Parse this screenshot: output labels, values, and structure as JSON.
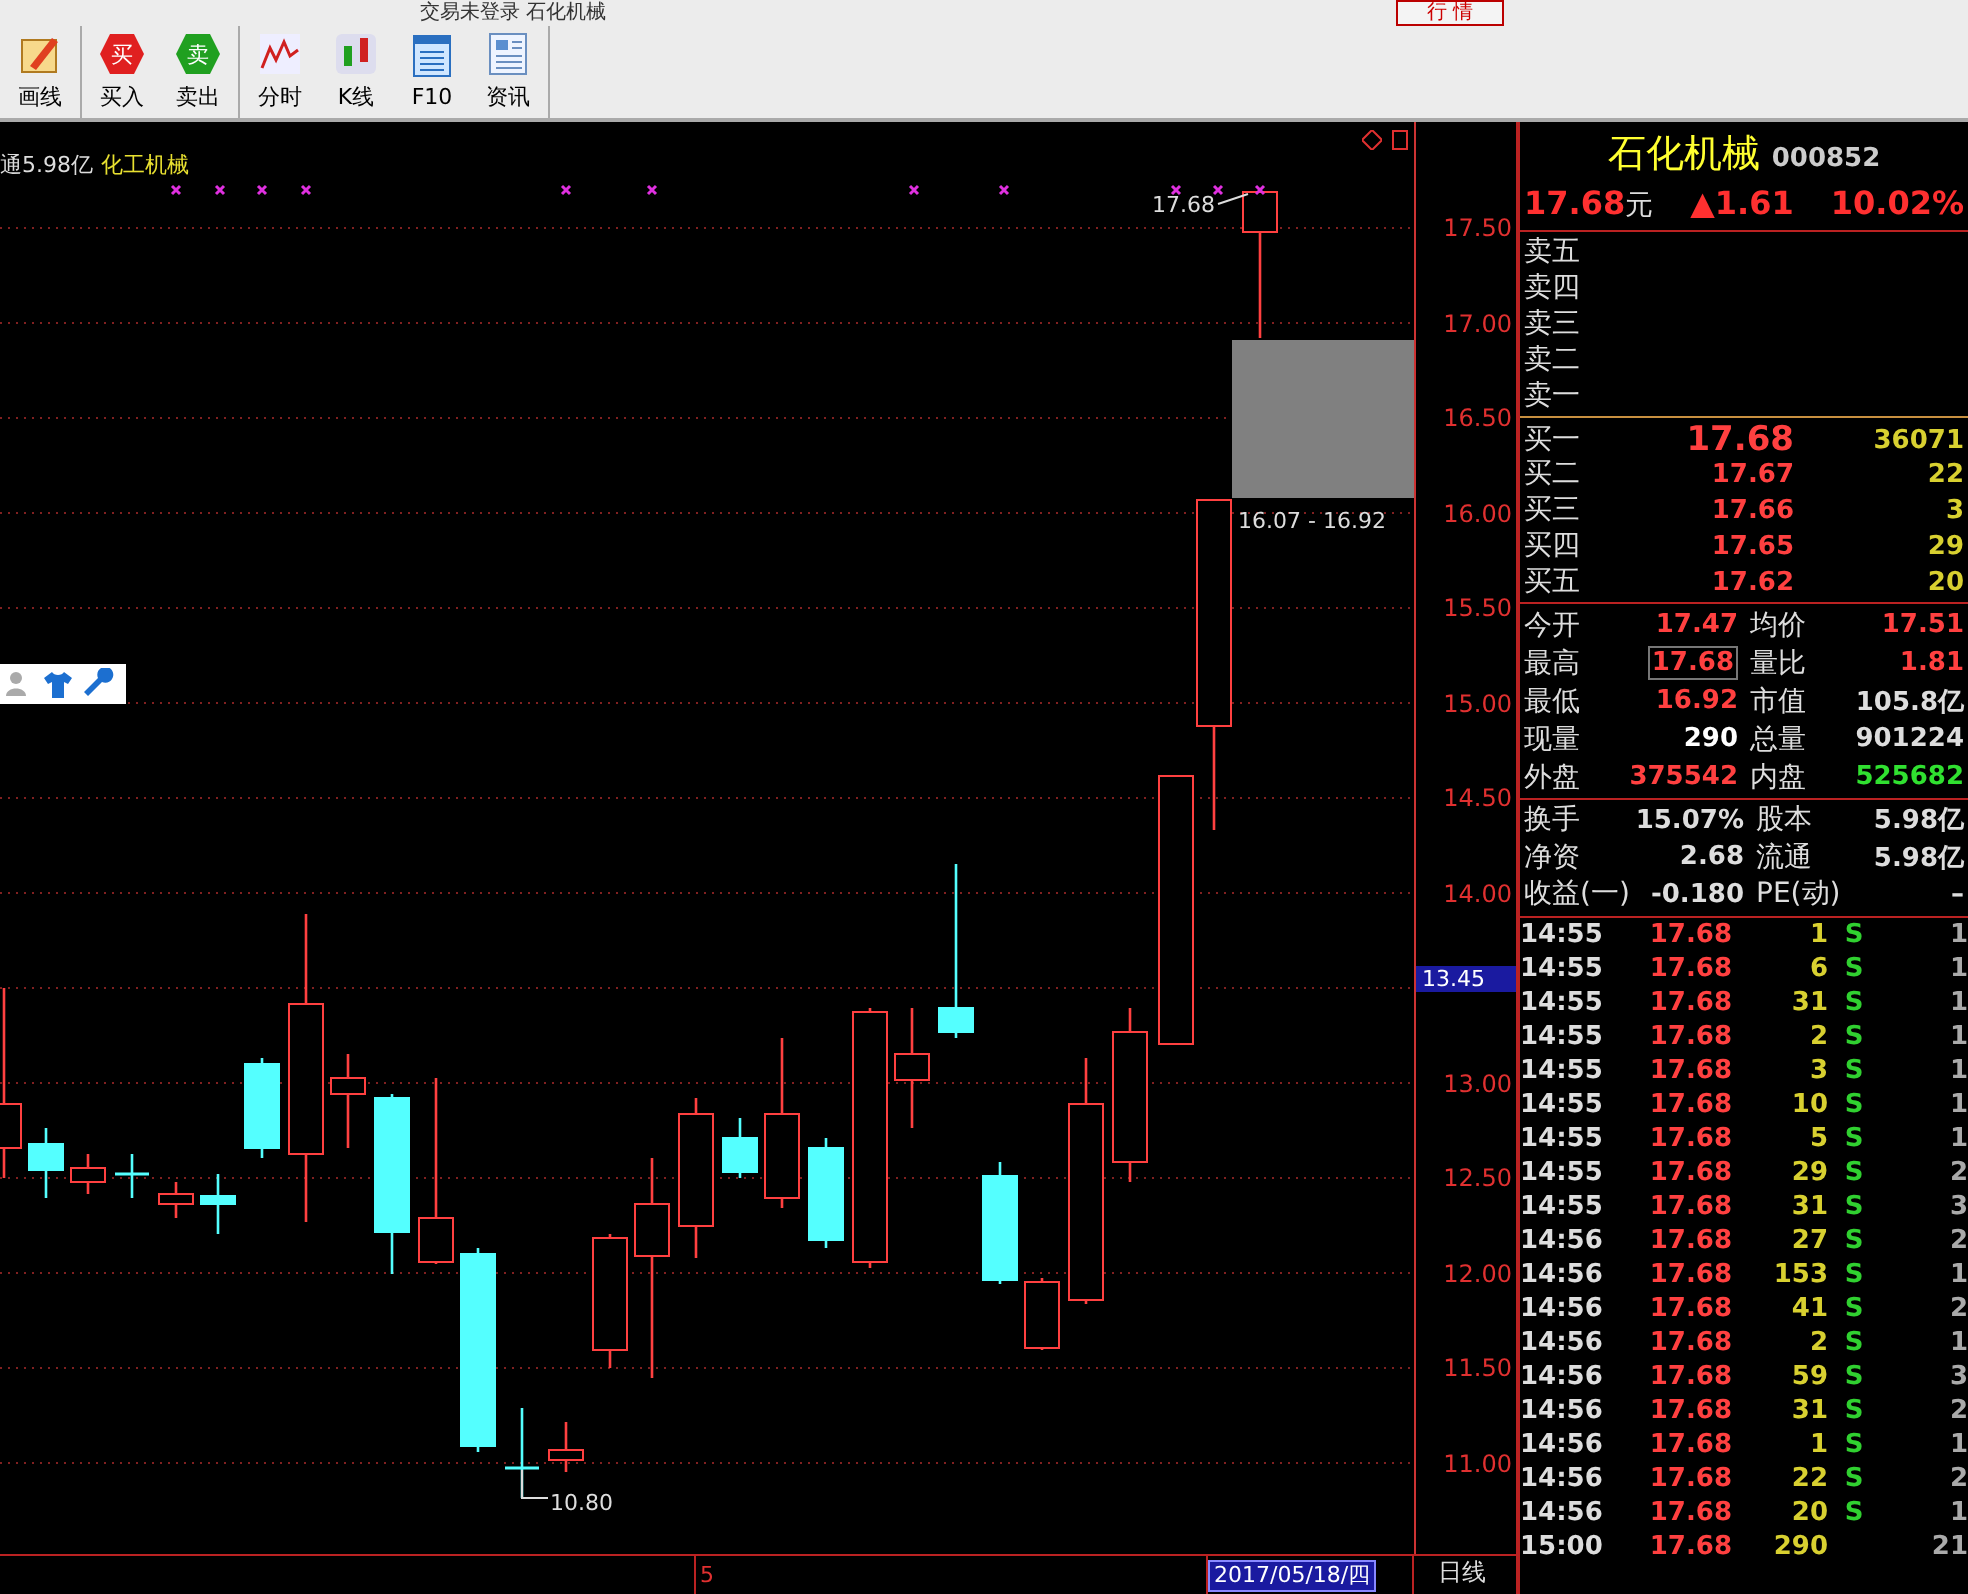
{
  "window": {
    "title": "交易未登录  石化机械",
    "mode_button": "行 情"
  },
  "toolbar": {
    "groups": [
      [
        {
          "label": "画线",
          "kind": "draw"
        }
      ],
      [
        {
          "label": "买入",
          "kind": "buy",
          "glyph": "买"
        },
        {
          "label": "卖出",
          "kind": "sell",
          "glyph": "卖"
        }
      ],
      [
        {
          "label": "分时",
          "kind": "timeline"
        },
        {
          "label": "K线",
          "kind": "kline"
        },
        {
          "label": "F10",
          "kind": "f10"
        },
        {
          "label": "资讯",
          "kind": "news"
        }
      ]
    ]
  },
  "chart": {
    "float_label": "通5.98亿",
    "sector": "化工机械",
    "price_ticks": [
      "17.50",
      "17.00",
      "16.50",
      "16.00",
      "15.50",
      "15.00",
      "14.50",
      "14.00",
      "13.00",
      "12.50",
      "12.00",
      "11.50",
      "11.00"
    ],
    "cursor_price": "13.45",
    "high_label": "17.68",
    "low_label": "10.80",
    "gap_label": "16.07 - 16.92",
    "period_label": "5",
    "date": "2017/05/18/四",
    "interval": "日线"
  },
  "quote": {
    "name": "石化机械",
    "code": "000852",
    "price": "17.68",
    "unit": "元",
    "change": "▲1.61",
    "percent": "10.02%"
  },
  "asks": [
    {
      "label": "卖五"
    },
    {
      "label": "卖四"
    },
    {
      "label": "卖三"
    },
    {
      "label": "卖二"
    },
    {
      "label": "卖一"
    }
  ],
  "bids": [
    {
      "label": "买一",
      "price": "17.68",
      "volume": "36071"
    },
    {
      "label": "买二",
      "price": "17.67",
      "volume": "22"
    },
    {
      "label": "买三",
      "price": "17.66",
      "volume": "3"
    },
    {
      "label": "买四",
      "price": "17.65",
      "volume": "29"
    },
    {
      "label": "买五",
      "price": "17.62",
      "volume": "20"
    }
  ],
  "stats": [
    [
      {
        "label": "今开",
        "value": "17.47",
        "color": "#ff4040",
        "highlighted": false
      },
      {
        "label": "均价",
        "value": "17.51",
        "color": "#ff4040",
        "highlighted": false
      }
    ],
    [
      {
        "label": "最高",
        "value": "17.68",
        "color": "#ff4040",
        "highlighted": true
      },
      {
        "label": "量比",
        "value": "1.81",
        "color": "#ff4040",
        "highlighted": false
      }
    ],
    [
      {
        "label": "最低",
        "value": "16.92",
        "color": "#ff4040",
        "highlighted": false
      },
      {
        "label": "市值",
        "value": "105.8亿",
        "color": "#dddddd",
        "highlighted": false
      }
    ],
    [
      {
        "label": "现量",
        "value": "290",
        "color": "#ffffff",
        "highlighted": false
      },
      {
        "label": "总量",
        "value": "901224",
        "color": "#dddddd",
        "highlighted": false
      }
    ],
    [
      {
        "label": "外盘",
        "value": "375542",
        "color": "#ff4040",
        "highlighted": false
      },
      {
        "label": "内盘",
        "value": "525682",
        "color": "#30e030",
        "highlighted": false
      }
    ]
  ],
  "fundamentals": [
    [
      {
        "label": "换手",
        "value": "15.07%"
      },
      {
        "label": "股本",
        "value": "5.98亿"
      }
    ],
    [
      {
        "label": "净资",
        "value": "2.68"
      },
      {
        "label": "流通",
        "value": "5.98亿"
      }
    ],
    [
      {
        "label": "收益(一)",
        "value": "-0.180"
      },
      {
        "label": "PE(动)",
        "value": "–"
      }
    ]
  ],
  "trades": [
    {
      "time": "14:55",
      "price": "17.68",
      "volume": "1",
      "side": "S",
      "count": "1"
    },
    {
      "time": "14:55",
      "price": "17.68",
      "volume": "6",
      "side": "S",
      "count": "1"
    },
    {
      "time": "14:55",
      "price": "17.68",
      "volume": "31",
      "side": "S",
      "count": "1"
    },
    {
      "time": "14:55",
      "price": "17.68",
      "volume": "2",
      "side": "S",
      "count": "1"
    },
    {
      "time": "14:55",
      "price": "17.68",
      "volume": "3",
      "side": "S",
      "count": "1"
    },
    {
      "time": "14:55",
      "price": "17.68",
      "volume": "10",
      "side": "S",
      "count": "1"
    },
    {
      "time": "14:55",
      "price": "17.68",
      "volume": "5",
      "side": "S",
      "count": "1"
    },
    {
      "time": "14:55",
      "price": "17.68",
      "volume": "29",
      "side": "S",
      "count": "2"
    },
    {
      "time": "14:55",
      "price": "17.68",
      "volume": "31",
      "side": "S",
      "count": "3"
    },
    {
      "time": "14:56",
      "price": "17.68",
      "volume": "27",
      "side": "S",
      "count": "2"
    },
    {
      "time": "14:56",
      "price": "17.68",
      "volume": "153",
      "side": "S",
      "count": "1"
    },
    {
      "time": "14:56",
      "price": "17.68",
      "volume": "41",
      "side": "S",
      "count": "2"
    },
    {
      "time": "14:56",
      "price": "17.68",
      "volume": "2",
      "side": "S",
      "count": "1"
    },
    {
      "time": "14:56",
      "price": "17.68",
      "volume": "59",
      "side": "S",
      "count": "3"
    },
    {
      "time": "14:56",
      "price": "17.68",
      "volume": "31",
      "side": "S",
      "count": "2"
    },
    {
      "time": "14:56",
      "price": "17.68",
      "volume": "1",
      "side": "S",
      "count": "1"
    },
    {
      "time": "14:56",
      "price": "17.68",
      "volume": "22",
      "side": "S",
      "count": "2"
    },
    {
      "time": "14:56",
      "price": "17.68",
      "volume": "20",
      "side": "S",
      "count": "1"
    },
    {
      "time": "15:00",
      "price": "17.68",
      "volume": "290",
      "count": "21"
    }
  ]
}
